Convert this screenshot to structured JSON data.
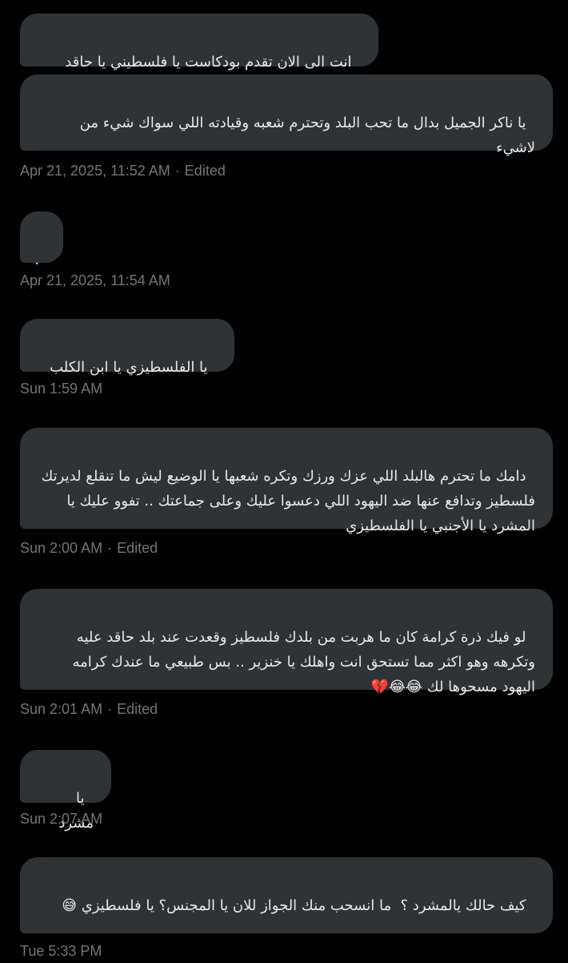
{
  "conversation": {
    "messages": [
      {
        "text": "انت الى الان تقدم بودكاست يا فلسطيني يا حاقد"
      },
      {
        "text": "يا ناكر الجميل بدال ما تحب البلد وتحترم شعبه وقيادته اللي سواك شيء من لاشيء"
      },
      {
        "text": "."
      },
      {
        "text": "يا الفلسطيزي يا ابن الكلب"
      },
      {
        "text": "دامك ما تحترم هالبلد اللي عزك ورزك وتكره شعبها يا الوضيع ليش ما تنقلع لديرتك فلسطيز وتدافع عنها ضد اليهود اللي دعسوا عليك وعلى جماعتك .. تفوو عليك يا المشرد يا الأجنبي يا الفلسطيزي"
      },
      {
        "text": "لو فيك ذرة كرامة كان ما هربت من بلدك فلسطيز وقعدت عند بلد حاقد عليه وتكرهه وهو اكثر مما تستحق انت واهلك يا خنزير .. بس طبيعي ما عندك كرامه اليهود مسحوها لك 😂😂💔"
      },
      {
        "text": "يا مشرد"
      },
      {
        "text": "كيف حالك يالمشرد ؟  ما انسحب منك الجواز للان يا المجنس؟ يا فلسطيزي 😅"
      }
    ],
    "timestamps": [
      {
        "time": "Apr 21, 2025, 11:52 AM",
        "edited": "Edited"
      },
      {
        "time": "Apr 21, 2025, 11:54 AM"
      },
      {
        "time": "Sun 1:59 AM"
      },
      {
        "time": "Sun 2:00 AM",
        "edited": "Edited"
      },
      {
        "time": "Sun 2:01 AM",
        "edited": "Edited"
      },
      {
        "time": "Sun 2:07 AM"
      },
      {
        "time": "Tue 5:33 PM"
      }
    ],
    "separator": "·"
  },
  "colors": {
    "background": "#000000",
    "bubble": "#2f3336",
    "text": "#e7e9ea",
    "meta": "#71767b"
  }
}
